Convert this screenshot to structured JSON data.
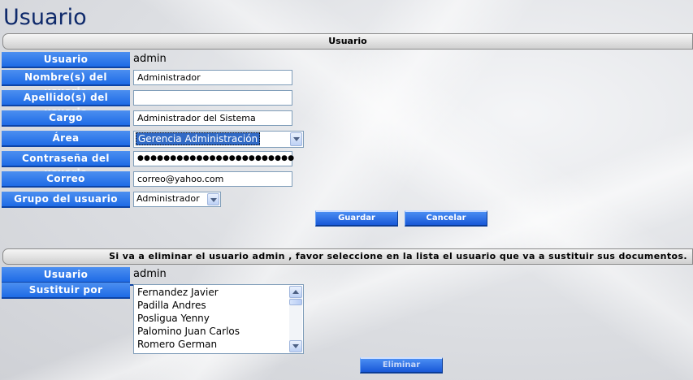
{
  "page": {
    "title": "Usuario"
  },
  "user_section": {
    "header": "Usuario",
    "fields": {
      "usuario": {
        "label": "Usuario",
        "value": "admin"
      },
      "nombre": {
        "label": "Nombre(s) del usuario",
        "value": "Administrador"
      },
      "apellido": {
        "label": "Apellido(s) del usuario",
        "value": ""
      },
      "cargo": {
        "label": "Cargo",
        "value": "Administrador del Sistema"
      },
      "area": {
        "label": "Área",
        "selected": "Gerencia Administración"
      },
      "contrasena": {
        "label": "Contraseña del usuario",
        "value": "●●●●●●●●●●●●●●●●●●●●●●●●"
      },
      "correo": {
        "label": "Correo",
        "value": "correo@yahoo.com"
      },
      "grupo": {
        "label": "Grupo del usuario",
        "selected": "Administrador"
      }
    },
    "buttons": {
      "save": "Guardar",
      "cancel": "Cancelar"
    }
  },
  "delete_section": {
    "header": "Si va a eliminar el usuario admin , favor seleccione en la lista el usuario que va a sustituir sus documentos.",
    "usuario": {
      "label": "Usuario",
      "value": "admin"
    },
    "sustituir": {
      "label": "Sustituir por",
      "options": [
        "Fernandez Javier",
        "Padilla Andres",
        "Posligua Yenny",
        "Palomino Juan Carlos",
        "Romero German"
      ]
    },
    "buttons": {
      "delete": "Eliminar"
    }
  },
  "colors": {
    "label_blue": "#1e6be6",
    "title_navy": "#0f2a6b"
  },
  "icons": [
    "chevron-down-icon",
    "scroll-up-icon",
    "scroll-down-icon"
  ]
}
